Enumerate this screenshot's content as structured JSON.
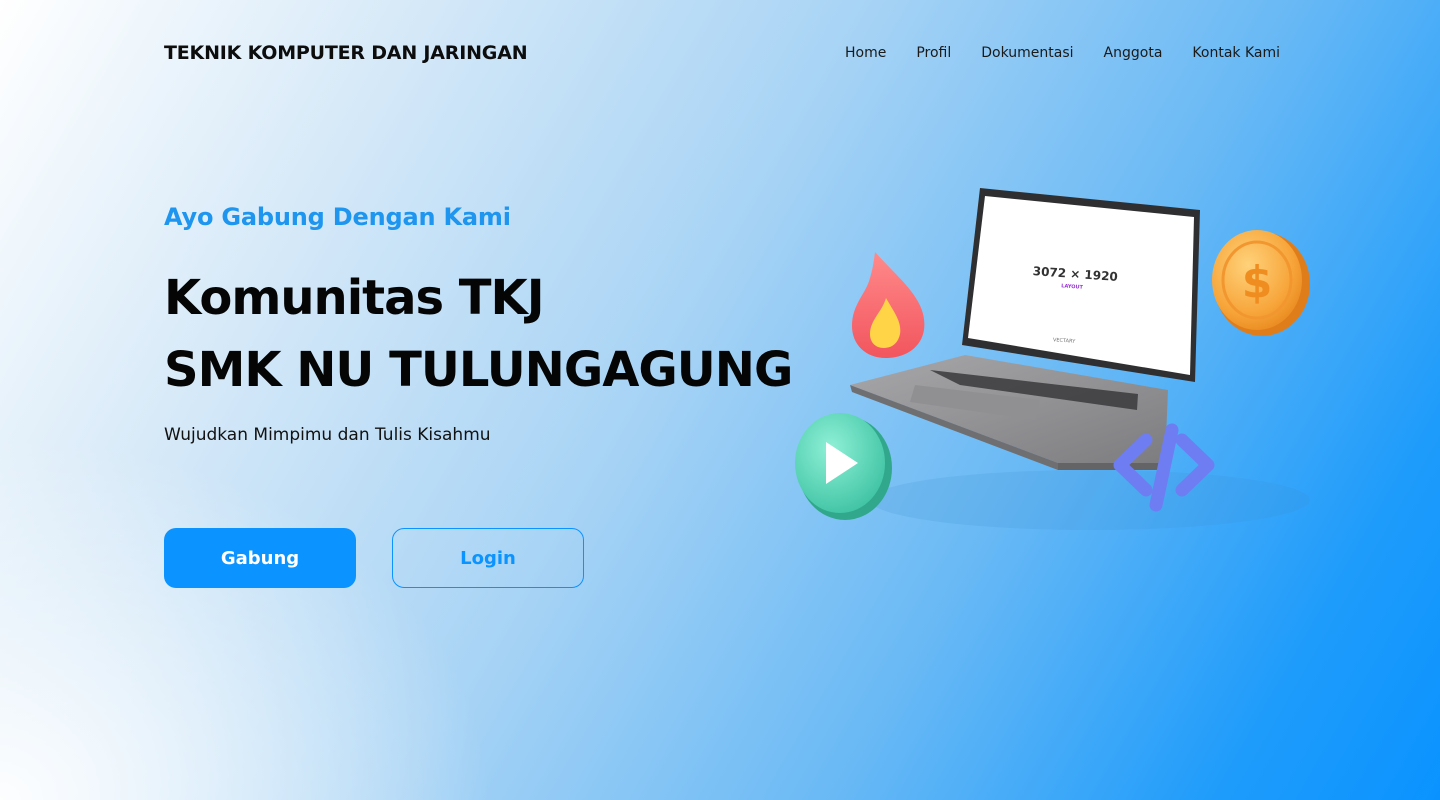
{
  "header": {
    "brand": "TEKNIK KOMPUTER DAN JARINGAN",
    "nav": [
      {
        "label": "Home"
      },
      {
        "label": "Profil"
      },
      {
        "label": "Dokumentasi"
      },
      {
        "label": "Anggota"
      },
      {
        "label": "Kontak Kami"
      }
    ]
  },
  "hero": {
    "eyebrow": "Ayo Gabung Dengan Kami",
    "title_line1": "Komunitas TKJ",
    "title_line2": "SMK NU TULUNGAGUNG",
    "subtitle": "Wujudkan Mimpimu dan Tulis Kisahmu",
    "primary_button": "Gabung",
    "secondary_button": "Login"
  },
  "illustration": {
    "screen_text": "3072 × 1920",
    "screen_subtext": "LAYOUT",
    "screen_footer": "VECTARY",
    "icons": [
      "laptop-icon",
      "fire-icon",
      "dollar-coin-icon",
      "play-icon",
      "code-icon"
    ]
  },
  "colors": {
    "accent": "#0b93ff",
    "eyebrow": "#1e95ee",
    "text": "#050505"
  }
}
